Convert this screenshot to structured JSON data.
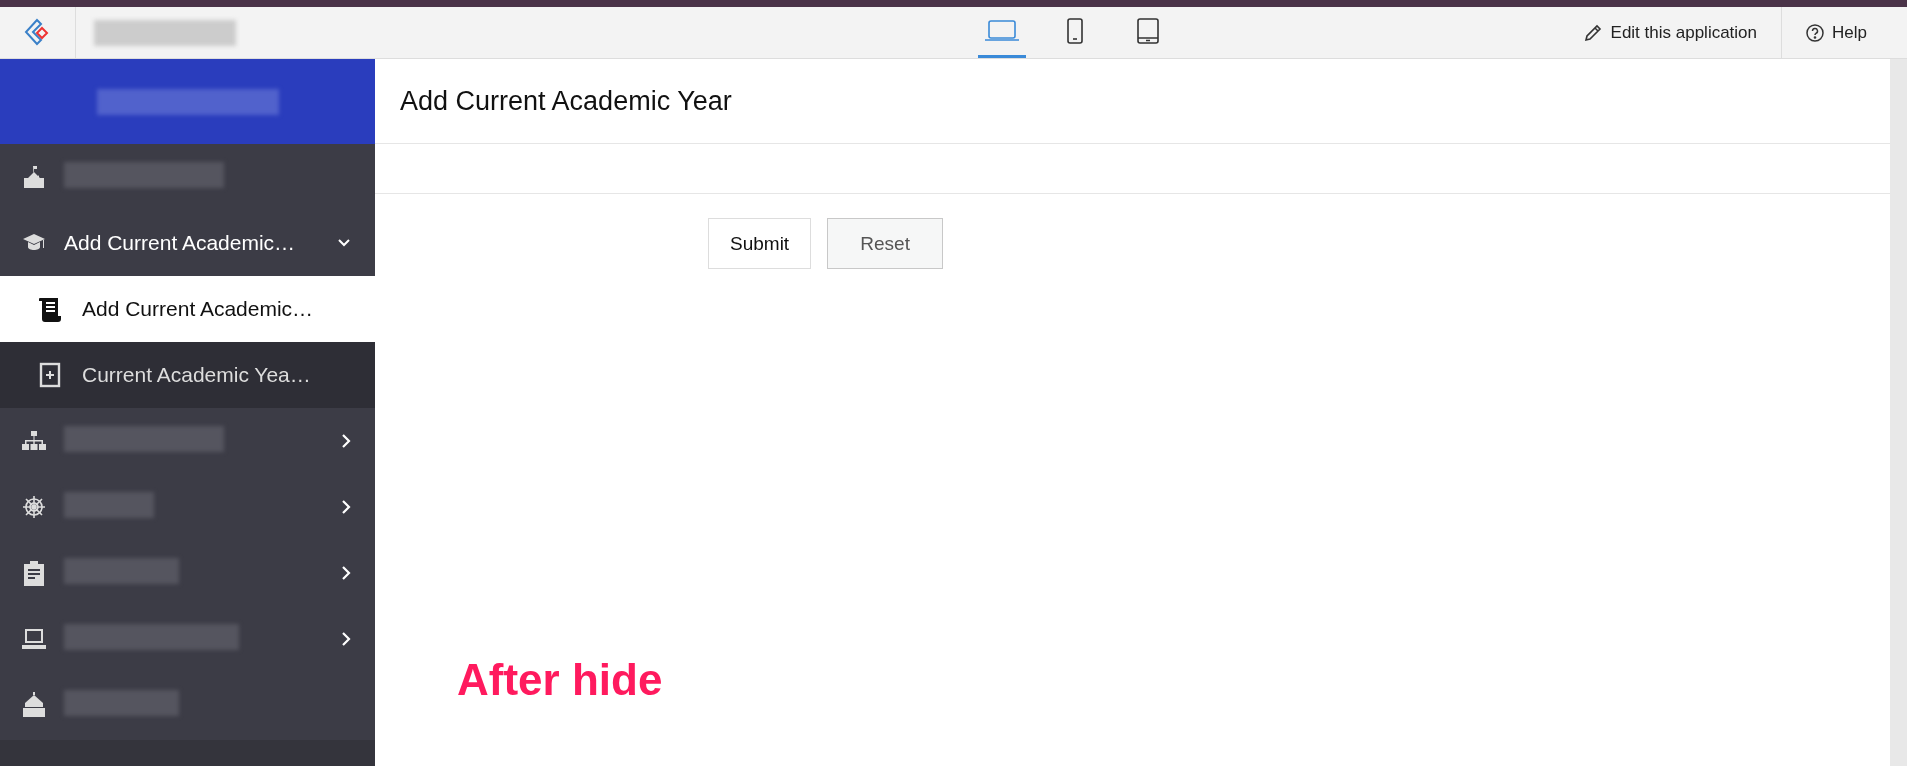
{
  "topbar": {
    "app_name": {
      "redacted": true
    },
    "devices": [
      {
        "selected": true
      },
      {
        "selected": false
      },
      {
        "selected": false
      }
    ],
    "edit_link": "Edit this application",
    "help": "Help"
  },
  "sidebar": {
    "title": {
      "redacted": true
    },
    "items": [
      {
        "redacted": true
      },
      {
        "label": "Add Current Academic…",
        "expanded": true,
        "children": [
          {
            "label": "Add Current Academic…",
            "selected": true
          },
          {
            "label": "Current Academic Yea…",
            "selected": false
          }
        ]
      },
      {
        "redacted": true,
        "expanded": false
      },
      {
        "redacted": true,
        "expanded": false
      },
      {
        "redacted": true,
        "expanded": false
      },
      {
        "redacted": true,
        "expanded": false
      },
      {
        "redacted": true
      }
    ]
  },
  "main": {
    "title": "Add Current Academic Year",
    "buttons": [
      {
        "label": "Submit",
        "kind": "primary"
      },
      {
        "label": "Reset",
        "kind": "secondary"
      }
    ]
  },
  "annotation": "After hide"
}
